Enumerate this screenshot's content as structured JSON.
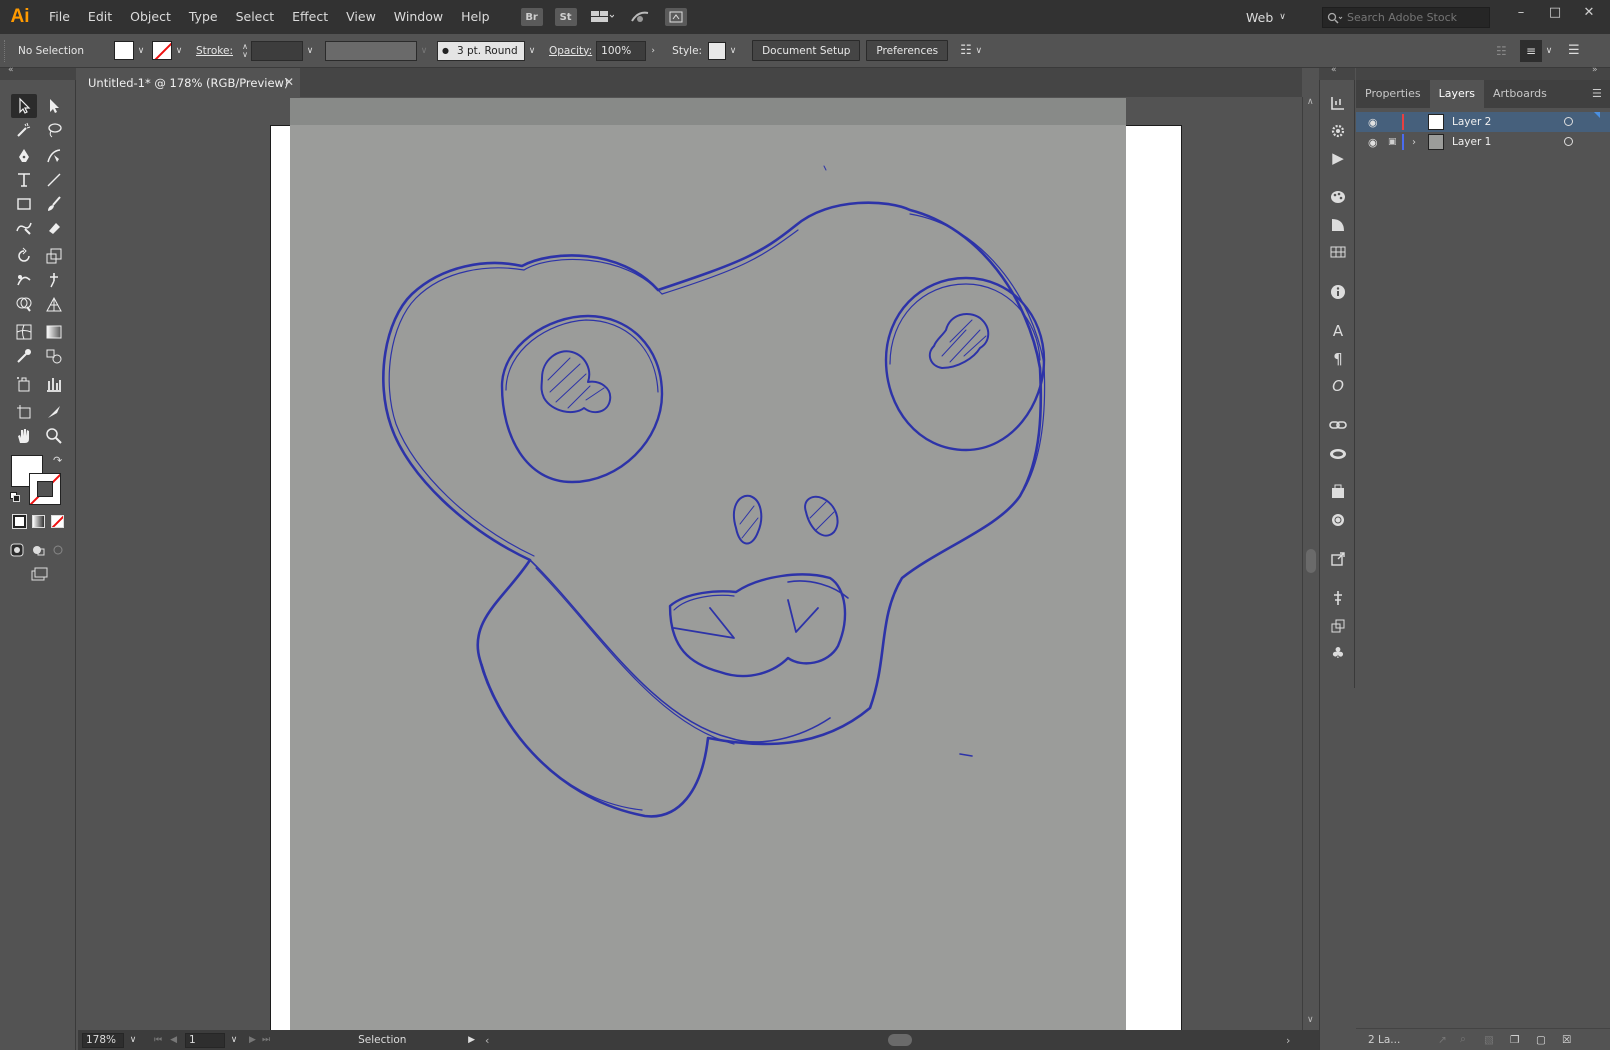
{
  "app": {
    "logo": "Ai"
  },
  "menu": [
    "File",
    "Edit",
    "Object",
    "Type",
    "Select",
    "Effect",
    "View",
    "Window",
    "Help"
  ],
  "menu_icons": {
    "bridge": "Br",
    "stock": "St"
  },
  "workspace": {
    "label": "Web"
  },
  "search": {
    "placeholder": "Search Adobe Stock"
  },
  "controlbar": {
    "selection": "No Selection",
    "stroke_label": "Stroke:",
    "brush": "3 pt. Round",
    "opacity_label": "Opacity:",
    "opacity_value": "100%",
    "style_label": "Style:",
    "document_setup": "Document Setup",
    "preferences": "Preferences"
  },
  "document": {
    "tab_title": "Untitled-1* @ 178% (RGB/Preview)"
  },
  "status": {
    "zoom": "178%",
    "artboard": "1",
    "tool": "Selection"
  },
  "panel": {
    "tabs": [
      "Properties",
      "Layers",
      "Artboards"
    ],
    "active_tab": "Layers",
    "layers": [
      {
        "name": "Layer 2",
        "color": "#e84040",
        "selected": true,
        "locked": false
      },
      {
        "name": "Layer 1",
        "color": "#4a6cf0",
        "selected": false,
        "locked": true
      }
    ],
    "footer": "2 La..."
  },
  "colors": {
    "ink": "#2d33a8",
    "paper": "#9b9c9a",
    "accent": "#ff9a00",
    "selected_row": "#46607c"
  }
}
